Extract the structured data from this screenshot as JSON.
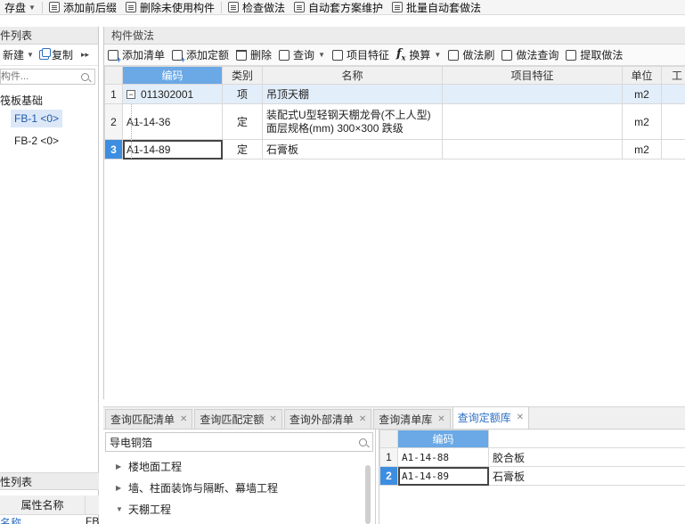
{
  "top_toolbar": {
    "save_label": "存盘",
    "add_prefix_label": "添加前后缀",
    "delete_unused_label": "删除未使用构件",
    "check_method_label": "检查做法",
    "auto_scheme_label": "自动套方案维护",
    "batch_auto_label": "批量自动套做法"
  },
  "left_panel": {
    "title": "件列表",
    "new_label": "新建",
    "copy_label": "复制",
    "search_placeholder": "构件...",
    "tree_root": "筏板基础",
    "tree_items": [
      "FB-1 <0>",
      "FB-2 <0>"
    ],
    "props_title": "性列表",
    "props_header": "属性名称",
    "props_row_name": "名称",
    "props_row_value": "FB"
  },
  "main": {
    "title": "构件做法",
    "toolbar": {
      "add_list": "添加清单",
      "add_quota": "添加定额",
      "delete": "删除",
      "query": "查询",
      "item_feature": "项目特征",
      "convert": "换算",
      "method_brush": "做法刷",
      "method_query": "做法查询",
      "extract": "提取做法"
    },
    "columns": [
      "编码",
      "类别",
      "名称",
      "项目特征",
      "单位",
      "工"
    ],
    "rows": [
      {
        "rn": "1",
        "code": "011302001",
        "type": "项",
        "name": "吊顶天棚",
        "name2": "",
        "feature": "",
        "unit": "m2"
      },
      {
        "rn": "2",
        "code": "A1-14-36",
        "type": "定",
        "name": "装配式U型轻钢天棚龙骨(不上人型)",
        "name2": "面层规格(mm) 300×300 跌级",
        "feature": "",
        "unit": "m2"
      },
      {
        "rn": "3",
        "code": "A1-14-89",
        "type": "定",
        "name": "石膏板",
        "name2": "",
        "feature": "",
        "unit": "m2"
      }
    ]
  },
  "bottom_tabs": [
    "查询匹配清单",
    "查询匹配定额",
    "查询外部清单",
    "查询清单库",
    "查询定额库"
  ],
  "bottom_left": {
    "search_value": "导电铜箔",
    "tree": [
      {
        "label": "楼地面工程",
        "arrow": "▶"
      },
      {
        "label": "墙、柱面装饰与隔断、幕墙工程",
        "arrow": "▶"
      },
      {
        "label": "天棚工程",
        "arrow": "▼"
      }
    ]
  },
  "bottom_right": {
    "column": "编码",
    "rows": [
      {
        "rn": "1",
        "code": "A1-14-88",
        "name": "胶合板"
      },
      {
        "rn": "2",
        "code": "A1-14-89",
        "name": "石膏板"
      }
    ]
  },
  "colors": {
    "accent": "#2d6fc4",
    "header_selected": "#6aa8e6",
    "row_highlight": "#e3eefb"
  }
}
